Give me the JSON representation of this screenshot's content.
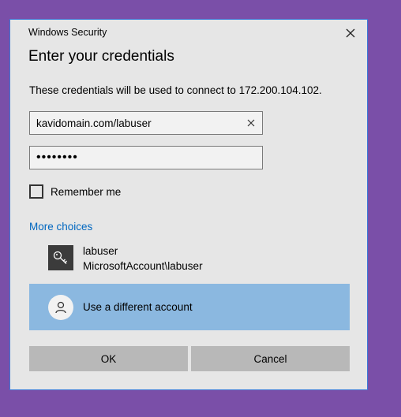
{
  "window": {
    "title": "Windows Security",
    "close_icon": "close-icon"
  },
  "dialog": {
    "heading": "Enter your credentials",
    "description": "These credentials will be used to connect to 172.200.104.102."
  },
  "form": {
    "username_value": "kavidomain.com/labuser",
    "password_value": "••••••••",
    "remember_label": "Remember me",
    "remember_checked": false
  },
  "more_choices": {
    "label": "More choices",
    "accounts": [
      {
        "name": "labuser",
        "detail": "MicrosoftAccount\\labuser",
        "icon": "key-icon"
      }
    ],
    "different_account_label": "Use a different account"
  },
  "buttons": {
    "ok": "OK",
    "cancel": "Cancel"
  },
  "colors": {
    "desktop": "#7a4fa8",
    "dialog_bg": "#e6e6e6",
    "link": "#0067c0",
    "selected_row": "#8bb8e0",
    "button": "#b8b8b8"
  }
}
